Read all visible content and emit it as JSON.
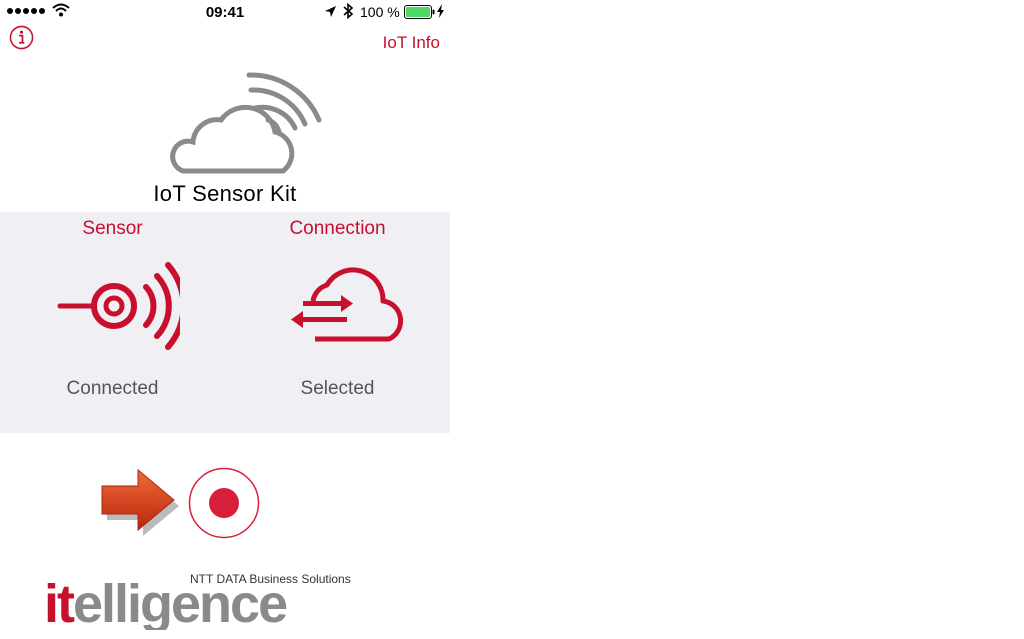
{
  "status_bar": {
    "time": "09:41",
    "battery_percent": "100 %",
    "battery_level": 1.0
  },
  "nav": {
    "info_link": "IoT Info",
    "info_icon": "info-circle-icon"
  },
  "header": {
    "title": "IoT Sensor Kit",
    "logo_icon": "cloud-signal-icon"
  },
  "status_panel": {
    "sensor": {
      "label": "Sensor",
      "state": "Connected",
      "icon": "sensor-signal-icon"
    },
    "connection": {
      "label": "Connection",
      "state": "Selected",
      "icon": "cloud-transfer-icon"
    }
  },
  "actions": {
    "record_icon": "record-icon",
    "arrow_icon": "arrow-right-icon"
  },
  "brand": {
    "name": "itelligence",
    "tagline": "NTT DATA Business Solutions"
  },
  "colors": {
    "accent": "#c8102e",
    "panel_bg": "#efeff4",
    "gray": "#8a8a8a",
    "record_red": "#d71f3a",
    "battery_green": "#4cd964"
  }
}
